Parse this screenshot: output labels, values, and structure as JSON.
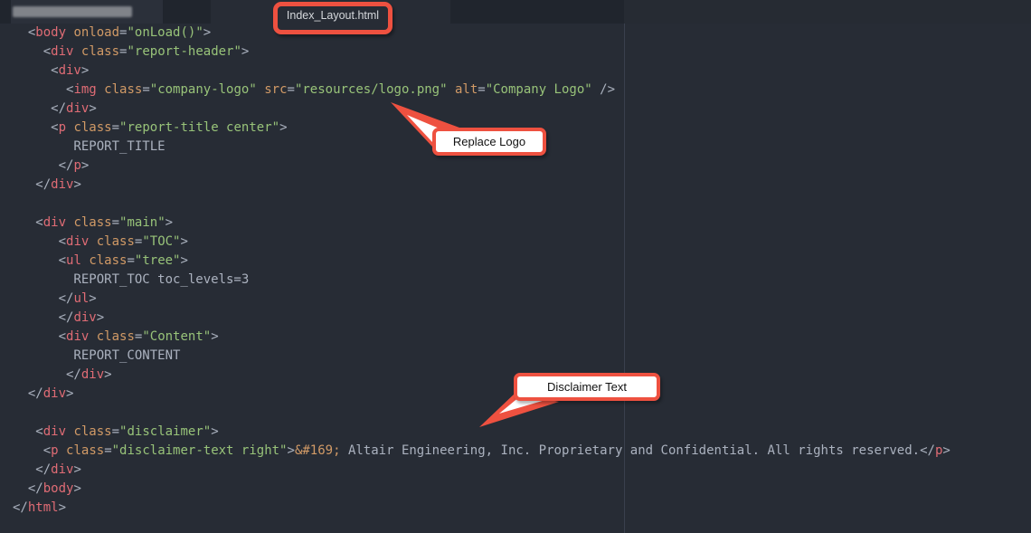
{
  "editor": {
    "tab": {
      "filename": "Index_Layout.html"
    },
    "colors": {
      "accent_red": "#ee5140",
      "editor_bg": "#272c35",
      "tab_bar_bg": "#20252d",
      "inactive_tab_bg": "#2b303a",
      "right_bar_bg": "#262b33",
      "wrap_guide": "#3a404d",
      "tag": "#e06c75",
      "attribute": "#d19a66",
      "string": "#98c379",
      "entity": "#d19a66",
      "plain_text": "#abb2bf",
      "callout_bg": "#ffffff",
      "callout_text": "#111111",
      "tab_text": "#d5d8dc"
    },
    "code": {
      "lines": [
        [
          {
            "t": "plain",
            "s": "  <"
          },
          {
            "t": "tag",
            "s": "body"
          },
          {
            "t": "plain",
            "s": " "
          },
          {
            "t": "attr",
            "s": "onload"
          },
          {
            "t": "plain",
            "s": "="
          },
          {
            "t": "str",
            "s": "\"onLoad()\""
          },
          {
            "t": "plain",
            "s": ">"
          }
        ],
        [
          {
            "t": "plain",
            "s": "    <"
          },
          {
            "t": "tag",
            "s": "div"
          },
          {
            "t": "plain",
            "s": " "
          },
          {
            "t": "attr",
            "s": "class"
          },
          {
            "t": "plain",
            "s": "="
          },
          {
            "t": "str",
            "s": "\"report-header\""
          },
          {
            "t": "plain",
            "s": ">"
          }
        ],
        [
          {
            "t": "plain",
            "s": "     <"
          },
          {
            "t": "tag",
            "s": "div"
          },
          {
            "t": "plain",
            "s": ">"
          }
        ],
        [
          {
            "t": "plain",
            "s": "       <"
          },
          {
            "t": "tag",
            "s": "img"
          },
          {
            "t": "plain",
            "s": " "
          },
          {
            "t": "attr",
            "s": "class"
          },
          {
            "t": "plain",
            "s": "="
          },
          {
            "t": "str",
            "s": "\"company-logo\""
          },
          {
            "t": "plain",
            "s": " "
          },
          {
            "t": "attr",
            "s": "src"
          },
          {
            "t": "plain",
            "s": "="
          },
          {
            "t": "str",
            "s": "\"resources/logo.png\""
          },
          {
            "t": "plain",
            "s": " "
          },
          {
            "t": "attr",
            "s": "alt"
          },
          {
            "t": "plain",
            "s": "="
          },
          {
            "t": "str",
            "s": "\"Company Logo\""
          },
          {
            "t": "plain",
            "s": " />"
          }
        ],
        [
          {
            "t": "plain",
            "s": "     </"
          },
          {
            "t": "tag",
            "s": "div"
          },
          {
            "t": "plain",
            "s": ">"
          }
        ],
        [
          {
            "t": "plain",
            "s": "     <"
          },
          {
            "t": "tag",
            "s": "p"
          },
          {
            "t": "plain",
            "s": " "
          },
          {
            "t": "attr",
            "s": "class"
          },
          {
            "t": "plain",
            "s": "="
          },
          {
            "t": "str",
            "s": "\"report-title center\""
          },
          {
            "t": "plain",
            "s": ">"
          }
        ],
        [
          {
            "t": "plain",
            "s": "        REPORT_TITLE"
          }
        ],
        [
          {
            "t": "plain",
            "s": "      </"
          },
          {
            "t": "tag",
            "s": "p"
          },
          {
            "t": "plain",
            "s": ">"
          }
        ],
        [
          {
            "t": "plain",
            "s": "   </"
          },
          {
            "t": "tag",
            "s": "div"
          },
          {
            "t": "plain",
            "s": ">"
          }
        ],
        [],
        [
          {
            "t": "plain",
            "s": "   <"
          },
          {
            "t": "tag",
            "s": "div"
          },
          {
            "t": "plain",
            "s": " "
          },
          {
            "t": "attr",
            "s": "class"
          },
          {
            "t": "plain",
            "s": "="
          },
          {
            "t": "str",
            "s": "\"main\""
          },
          {
            "t": "plain",
            "s": ">"
          }
        ],
        [
          {
            "t": "plain",
            "s": "      <"
          },
          {
            "t": "tag",
            "s": "div"
          },
          {
            "t": "plain",
            "s": " "
          },
          {
            "t": "attr",
            "s": "class"
          },
          {
            "t": "plain",
            "s": "="
          },
          {
            "t": "str",
            "s": "\"TOC\""
          },
          {
            "t": "plain",
            "s": ">"
          }
        ],
        [
          {
            "t": "plain",
            "s": "      <"
          },
          {
            "t": "tag",
            "s": "ul"
          },
          {
            "t": "plain",
            "s": " "
          },
          {
            "t": "attr",
            "s": "class"
          },
          {
            "t": "plain",
            "s": "="
          },
          {
            "t": "str",
            "s": "\"tree\""
          },
          {
            "t": "plain",
            "s": ">"
          }
        ],
        [
          {
            "t": "plain",
            "s": "        REPORT_TOC toc_levels=3"
          }
        ],
        [
          {
            "t": "plain",
            "s": "      </"
          },
          {
            "t": "tag",
            "s": "ul"
          },
          {
            "t": "plain",
            "s": ">"
          }
        ],
        [
          {
            "t": "plain",
            "s": "      </"
          },
          {
            "t": "tag",
            "s": "div"
          },
          {
            "t": "plain",
            "s": ">"
          }
        ],
        [
          {
            "t": "plain",
            "s": "      <"
          },
          {
            "t": "tag",
            "s": "div"
          },
          {
            "t": "plain",
            "s": " "
          },
          {
            "t": "attr",
            "s": "class"
          },
          {
            "t": "plain",
            "s": "="
          },
          {
            "t": "str",
            "s": "\"Content\""
          },
          {
            "t": "plain",
            "s": ">"
          }
        ],
        [
          {
            "t": "plain",
            "s": "        REPORT_CONTENT"
          }
        ],
        [
          {
            "t": "plain",
            "s": "       </"
          },
          {
            "t": "tag",
            "s": "div"
          },
          {
            "t": "plain",
            "s": ">"
          }
        ],
        [
          {
            "t": "plain",
            "s": "  </"
          },
          {
            "t": "tag",
            "s": "div"
          },
          {
            "t": "plain",
            "s": ">"
          }
        ],
        [],
        [
          {
            "t": "plain",
            "s": "   <"
          },
          {
            "t": "tag",
            "s": "div"
          },
          {
            "t": "plain",
            "s": " "
          },
          {
            "t": "attr",
            "s": "class"
          },
          {
            "t": "plain",
            "s": "="
          },
          {
            "t": "str",
            "s": "\"disclaimer\""
          },
          {
            "t": "plain",
            "s": ">"
          }
        ],
        [
          {
            "t": "plain",
            "s": "    <"
          },
          {
            "t": "tag",
            "s": "p"
          },
          {
            "t": "plain",
            "s": " "
          },
          {
            "t": "attr",
            "s": "class"
          },
          {
            "t": "plain",
            "s": "="
          },
          {
            "t": "str",
            "s": "\"disclaimer-text right\""
          },
          {
            "t": "plain",
            "s": ">"
          },
          {
            "t": "ent",
            "s": "&#169;"
          },
          {
            "t": "plain",
            "s": " Altair Engineering, Inc. Proprietary and Confidential. All rights reserved."
          },
          {
            "t": "plain",
            "s": "</"
          },
          {
            "t": "tag",
            "s": "p"
          },
          {
            "t": "plain",
            "s": ">"
          }
        ],
        [
          {
            "t": "plain",
            "s": "   </"
          },
          {
            "t": "tag",
            "s": "div"
          },
          {
            "t": "plain",
            "s": ">"
          }
        ],
        [
          {
            "t": "plain",
            "s": "  </"
          },
          {
            "t": "tag",
            "s": "body"
          },
          {
            "t": "plain",
            "s": ">"
          }
        ],
        [
          {
            "t": "plain",
            "s": "</"
          },
          {
            "t": "tag",
            "s": "html"
          },
          {
            "t": "plain",
            "s": ">"
          }
        ]
      ]
    }
  },
  "annotations": {
    "replace_logo": {
      "label": "Replace Logo"
    },
    "disclaimer": {
      "label": "Disclaimer Text"
    }
  }
}
